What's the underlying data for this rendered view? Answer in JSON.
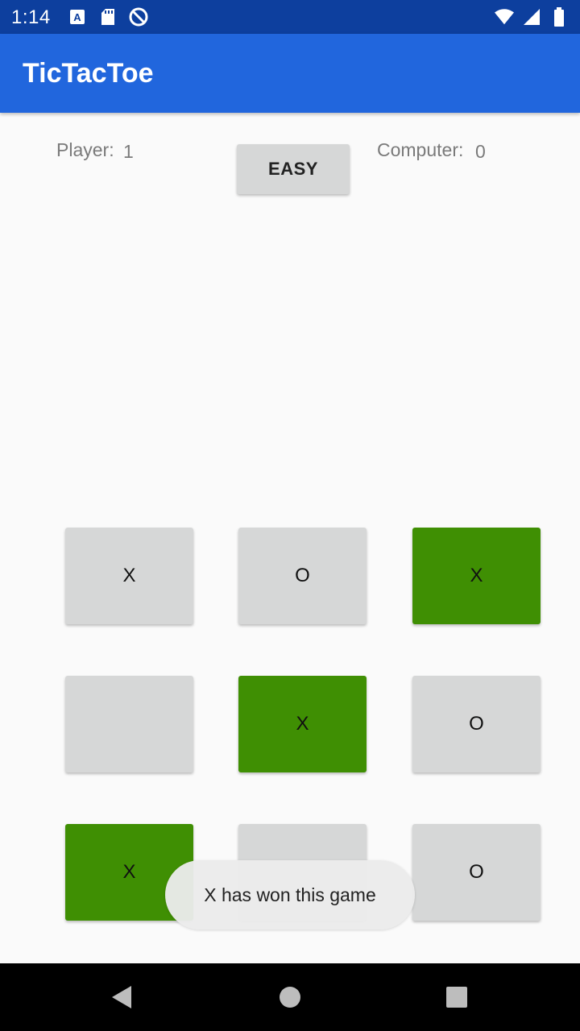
{
  "status_bar": {
    "time": "1:14",
    "left_icons": [
      "a-notification-icon",
      "sd-card-icon",
      "no-disturb-icon"
    ],
    "right_icons": [
      "wifi-icon",
      "cell-signal-icon",
      "battery-icon"
    ]
  },
  "app_bar": {
    "title": "TicTacToe"
  },
  "scores": {
    "player_label": "Player:",
    "player_value": "1",
    "computer_label": "Computer:",
    "computer_value": "0"
  },
  "difficulty_button": {
    "label": "EASY"
  },
  "board": {
    "cells": [
      {
        "mark": "X",
        "winning": false
      },
      {
        "mark": "O",
        "winning": false
      },
      {
        "mark": "X",
        "winning": true
      },
      {
        "mark": "",
        "winning": false
      },
      {
        "mark": "X",
        "winning": true
      },
      {
        "mark": "O",
        "winning": false
      },
      {
        "mark": "X",
        "winning": true
      },
      {
        "mark": "",
        "winning": false
      },
      {
        "mark": "O",
        "winning": false
      }
    ]
  },
  "toast": {
    "message": "X has won this game"
  },
  "colors": {
    "status_bar": "#0d3f9e",
    "app_bar": "#2166dd",
    "cell": "#d6d7d7",
    "winning_cell": "#3f8f03"
  },
  "nav_bar": {
    "icons": [
      "back-icon",
      "home-icon",
      "recents-icon"
    ]
  }
}
